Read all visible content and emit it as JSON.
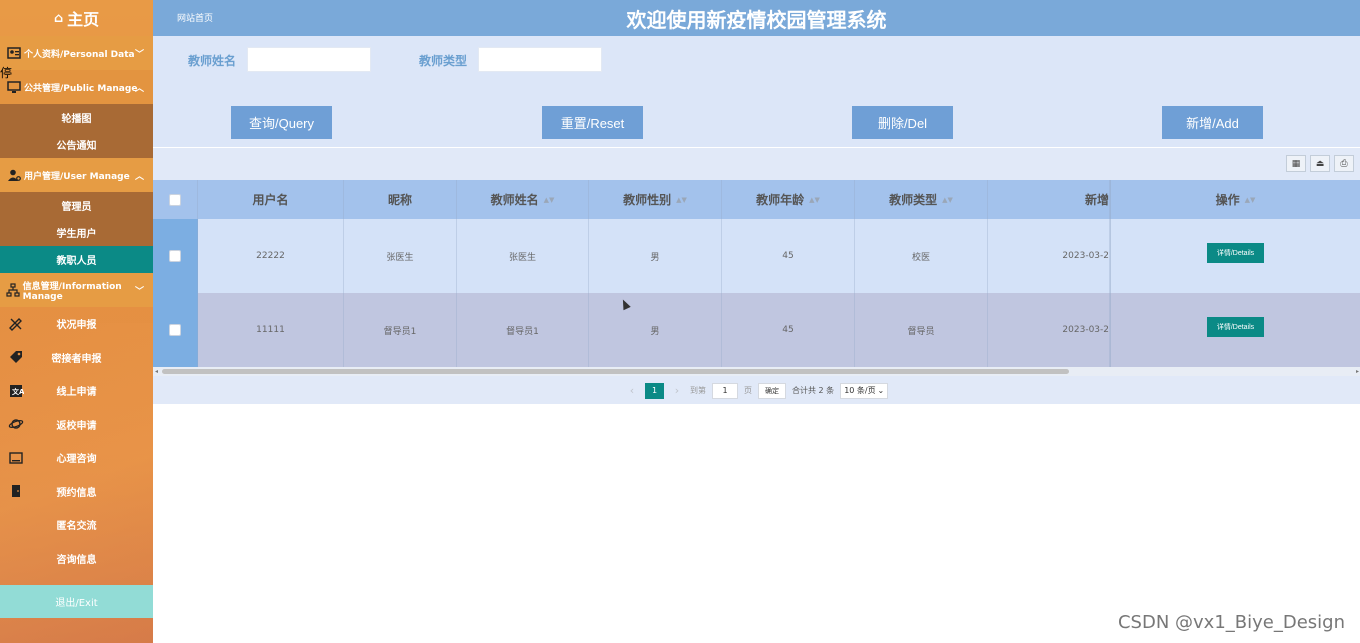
{
  "sidebar": {
    "home_label": "主页",
    "tooltip_fragment": "停",
    "groups": [
      {
        "label": "个人资料/Personal Data",
        "expanded": false,
        "items": []
      },
      {
        "label": "公共管理/Public Manage",
        "expanded": true,
        "items": [
          {
            "label": "轮播图"
          },
          {
            "label": "公告通知"
          }
        ]
      },
      {
        "label": "用户管理/User Manage",
        "expanded": true,
        "items": [
          {
            "label": "管理员"
          },
          {
            "label": "学生用户"
          },
          {
            "label": "教职人员",
            "active": true
          }
        ]
      },
      {
        "label": "信息管理/Information Manage",
        "expanded": false,
        "items": []
      }
    ],
    "leaves": [
      {
        "label": "状况申报",
        "icon": "pencil-ruler-icon"
      },
      {
        "label": "密接者申报",
        "icon": "tag-icon"
      },
      {
        "label": "线上申请",
        "icon": "translate-icon"
      },
      {
        "label": "返校申请",
        "icon": "planet-icon"
      },
      {
        "label": "心理咨询",
        "icon": "keyboard-icon"
      },
      {
        "label": "预约信息",
        "icon": "door-icon"
      },
      {
        "label": "匿名交流",
        "icon": ""
      },
      {
        "label": "咨询信息",
        "icon": ""
      }
    ],
    "exit_label": "退出/Exit"
  },
  "header": {
    "breadcrumb": "网站首页",
    "title": "欢迎使用新疫情校园管理系统"
  },
  "search": {
    "name_label": "教师姓名",
    "name_value": "",
    "type_label": "教师类型",
    "type_value": "",
    "query_button": "查询/Query",
    "reset_button": "重置/Reset",
    "delete_button": "删除/Del",
    "add_button": "新增/Add"
  },
  "table": {
    "columns": [
      "用户名",
      "昵称",
      "教师姓名",
      "教师性别",
      "教师年龄",
      "教师类型",
      "新增",
      "操作"
    ],
    "rows": [
      {
        "username": "22222",
        "nickname": "张医生",
        "teacher_name": "张医生",
        "gender": "男",
        "age": "45",
        "type": "校医",
        "date": "2023-03-2",
        "action": "详情/Details"
      },
      {
        "username": "11111",
        "nickname": "督导员1",
        "teacher_name": "督导员1",
        "gender": "男",
        "age": "45",
        "type": "督导员",
        "date": "2023-03-2",
        "action": "详情/Details"
      }
    ]
  },
  "pager": {
    "current_page": "1",
    "goto_prefix": "到第",
    "goto_value": "1",
    "goto_suffix": "页",
    "confirm": "确定",
    "total": "合计共 2 条",
    "page_size": "10 条/页"
  },
  "watermark": "CSDN @vx1_Biye_Design",
  "colors": {
    "sidebar": "#e59142",
    "submenu": "#a86a35",
    "active": "#0b8a86",
    "header": "#7aa9d9",
    "button": "#6f9fd6",
    "exit": "#92dcd6"
  }
}
